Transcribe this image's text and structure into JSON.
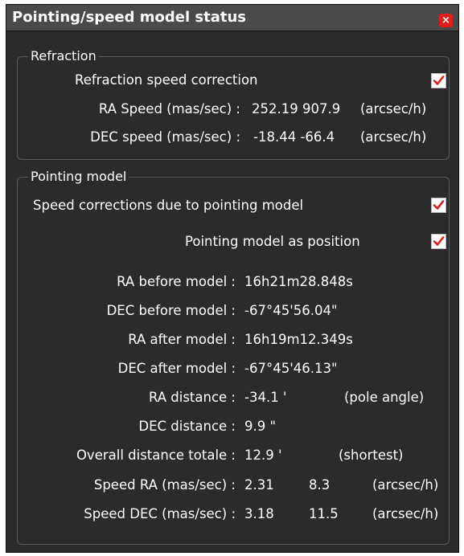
{
  "window": {
    "title": "Pointing/speed model status",
    "close_glyph": "×",
    "accent_color": "#e01c1c"
  },
  "refraction": {
    "group_title": "Refraction",
    "speed_correction_label": "Refraction speed correction",
    "speed_correction_checked": true,
    "ra_speed_label": "RA Speed (mas/sec) :",
    "ra_speed_value": "252.19 907.9",
    "ra_speed_unit": "(arcsec/h)",
    "dec_speed_label": "DEC speed (mas/sec) :",
    "dec_speed_value": "-18.44 -66.4",
    "dec_speed_unit": "(arcsec/h)"
  },
  "pointing": {
    "group_title": "Pointing model",
    "speed_corrections_label": "Speed corrections due to pointing model",
    "speed_corrections_checked": true,
    "model_as_position_label": "Pointing model as position",
    "model_as_position_checked": true,
    "ra_before_label": "RA before model :",
    "ra_before_value": "16h21m28.848s",
    "dec_before_label": "DEC before model :",
    "dec_before_value": "-67°45'56.04\"",
    "ra_after_label": "RA after model :",
    "ra_after_value": "16h19m12.349s",
    "dec_after_label": "DEC after model :",
    "dec_after_value": "-67°45'46.13\"",
    "ra_distance_label": "RA distance :",
    "ra_distance_value": "-34.1 '",
    "ra_distance_note": "(pole angle)",
    "dec_distance_label": "DEC distance :",
    "dec_distance_value": "9.9 \"",
    "overall_distance_label": "Overall distance totale :",
    "overall_distance_value": "12.9 '",
    "overall_distance_note": "(shortest)",
    "speed_ra_label": "Speed RA (mas/sec) :",
    "speed_ra_value": "2.31",
    "speed_ra_value2": "8.3",
    "speed_ra_unit": "(arcsec/h)",
    "speed_dec_label": "Speed DEC (mas/sec) :",
    "speed_dec_value": "3.18",
    "speed_dec_value2": "11.5",
    "speed_dec_unit": "(arcsec/h)"
  }
}
